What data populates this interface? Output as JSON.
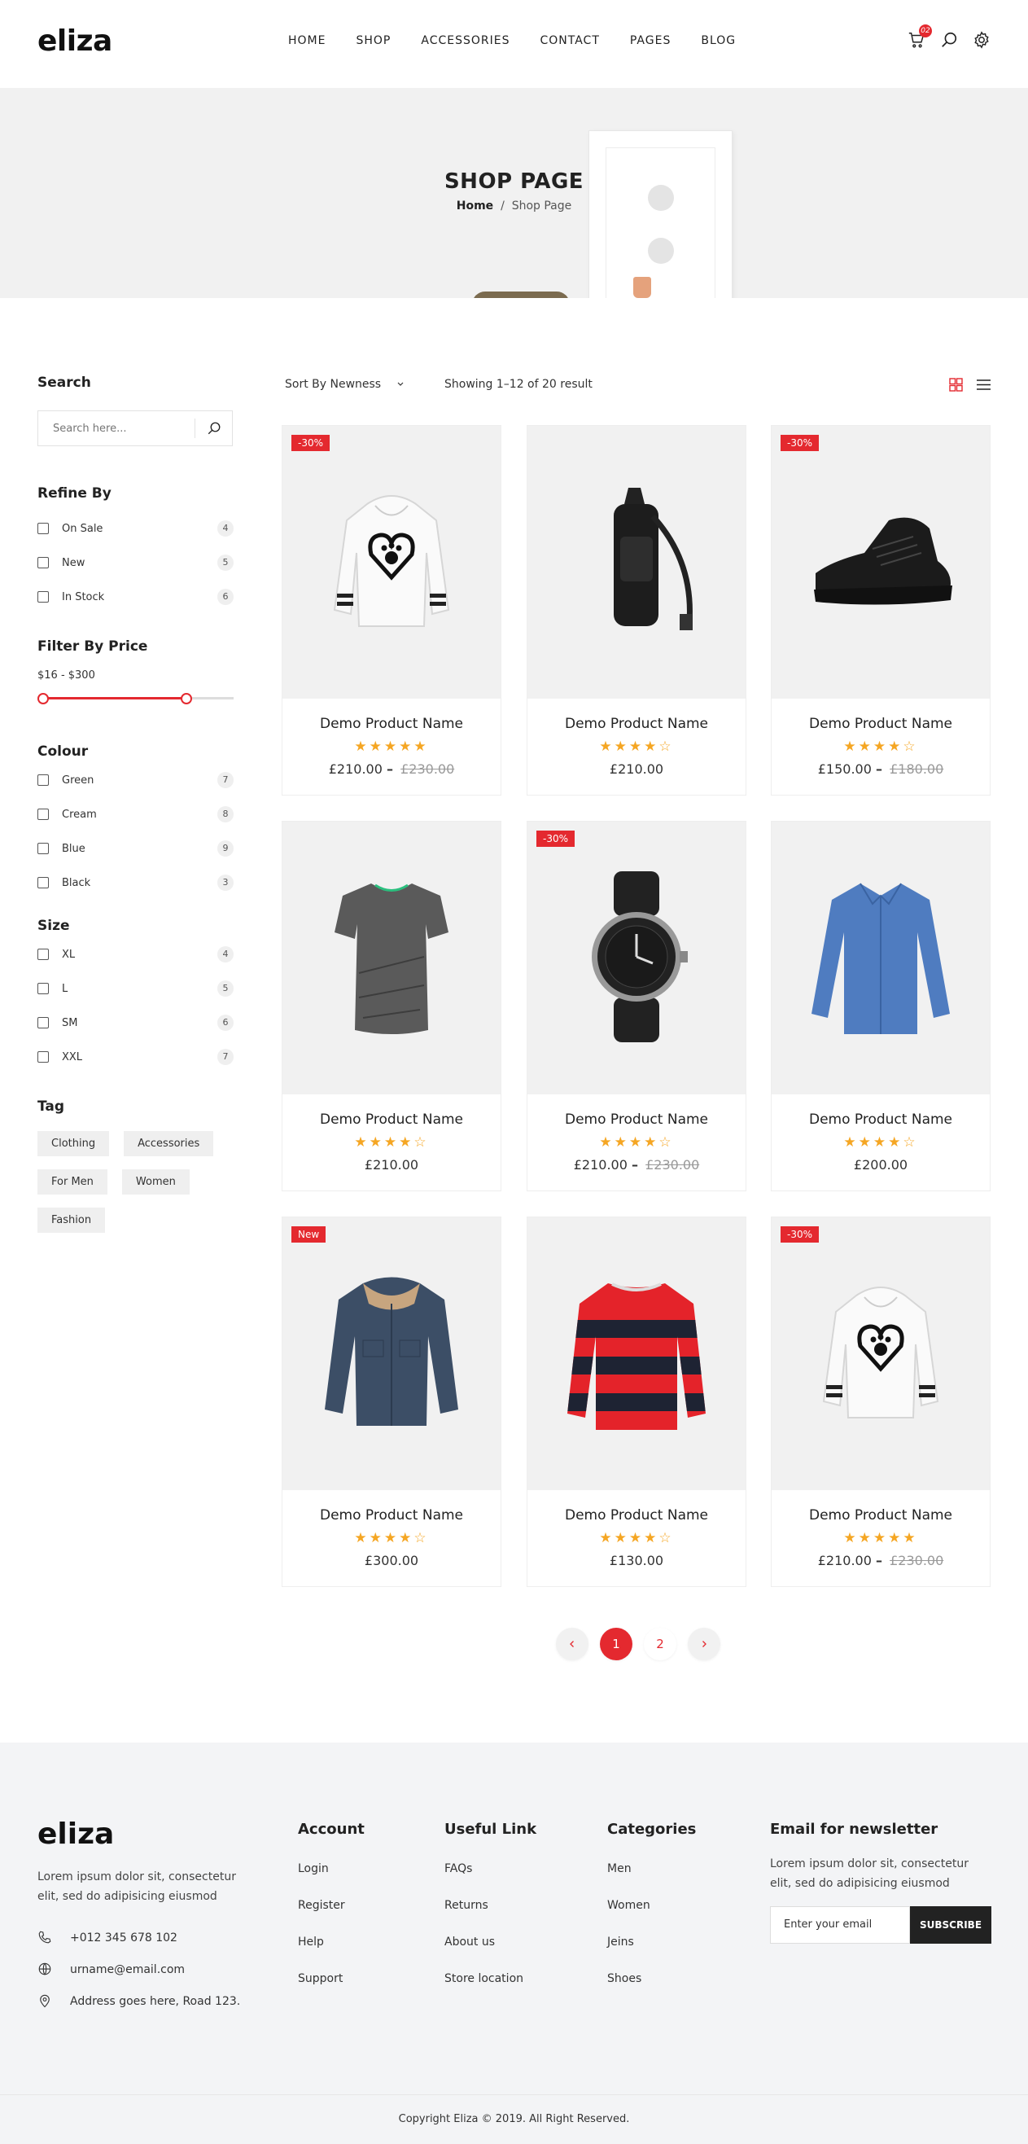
{
  "header": {
    "logo": "eliza",
    "nav": [
      "HOME",
      "SHOP",
      "ACCESSORIES",
      "CONTACT",
      "PAGES",
      "BLOG"
    ],
    "cart_count": "02"
  },
  "hero": {
    "title": "SHOP PAGE",
    "breadcrumb_home": "Home",
    "breadcrumb_sep": "/",
    "breadcrumb_current": "Shop Page"
  },
  "sidebar": {
    "search_title": "Search",
    "search_placeholder": "Search here...",
    "refine_title": "Refine By",
    "refine": [
      {
        "label": "On Sale",
        "count": "4"
      },
      {
        "label": "New",
        "count": "5"
      },
      {
        "label": "In Stock",
        "count": "6"
      }
    ],
    "price_title": "Filter By Price",
    "price_range": "$16 - $300",
    "colour_title": "Colour",
    "colours": [
      {
        "label": "Green",
        "count": "7"
      },
      {
        "label": "Cream",
        "count": "8"
      },
      {
        "label": "Blue",
        "count": "9"
      },
      {
        "label": "Black",
        "count": "3"
      }
    ],
    "size_title": "Size",
    "sizes": [
      {
        "label": "XL",
        "count": "4"
      },
      {
        "label": "L",
        "count": "5"
      },
      {
        "label": "SM",
        "count": "6"
      },
      {
        "label": "XXL",
        "count": "7"
      }
    ],
    "tag_title": "Tag",
    "tags": [
      "Clothing",
      "Accessories",
      "For Men",
      "Women",
      "Fashion"
    ]
  },
  "toolbar": {
    "sort_label": "Sort By Newness",
    "showing": "Showing 1–12 of 20 result"
  },
  "products": [
    {
      "name": "Demo Product Name",
      "badge": "-30%",
      "rating": 5,
      "price": "£210.00",
      "old_price": "£230.00",
      "image": "white-hoodie"
    },
    {
      "name": "Demo Product Name",
      "badge": "",
      "rating": 4.5,
      "price": "£210.00",
      "old_price": "",
      "image": "black-backpack"
    },
    {
      "name": "Demo Product Name",
      "badge": "-30%",
      "rating": 4.5,
      "price": "£150.00",
      "old_price": "£180.00",
      "image": "black-sneaker"
    },
    {
      "name": "Demo Product Name",
      "badge": "",
      "rating": 4.5,
      "price": "£210.00",
      "old_price": "",
      "image": "grey-tshirt"
    },
    {
      "name": "Demo Product Name",
      "badge": "-30%",
      "rating": 4.5,
      "price": "£210.00",
      "old_price": "£230.00",
      "image": "wrist-watch"
    },
    {
      "name": "Demo Product Name",
      "badge": "",
      "rating": 4.5,
      "price": "£200.00",
      "old_price": "",
      "image": "blue-shirt"
    },
    {
      "name": "Demo Product Name",
      "badge": "New",
      "rating": 4.5,
      "price": "£300.00",
      "old_price": "",
      "image": "denim-jacket"
    },
    {
      "name": "Demo Product Name",
      "badge": "",
      "rating": 4.5,
      "price": "£130.00",
      "old_price": "",
      "image": "striped-sweater"
    },
    {
      "name": "Demo Product Name",
      "badge": "-30%",
      "rating": 5,
      "price": "£210.00",
      "old_price": "£230.00",
      "image": "white-hoodie"
    }
  ],
  "pagination": [
    "1",
    "2"
  ],
  "footer": {
    "logo": "eliza",
    "desc": "Lorem ipsum dolor sit, consectetur elit, sed do adipisicing eiusmod",
    "phone": "+012 345 678 102",
    "email": "urname@email.com",
    "address": "Address goes here, Road 123.",
    "columns": [
      {
        "title": "Account",
        "links": [
          "Login",
          "Register",
          "Help",
          "Support"
        ]
      },
      {
        "title": "Useful Link",
        "links": [
          "FAQs",
          "Returns",
          "About us",
          "Store location"
        ]
      },
      {
        "title": "Categories",
        "links": [
          "Men",
          "Women",
          "Jeins",
          "Shoes"
        ]
      }
    ],
    "newsletter_title": "Email for newsletter",
    "newsletter_desc": "Lorem ipsum dolor sit, consectetur elit, sed do adipisicing eiusmod",
    "newsletter_placeholder": "Enter your email",
    "subscribe": "SUBSCRIBE",
    "copyright": "Copyright Eliza © 2019. All Right Reserved."
  },
  "colors": {
    "accent": "#e4292f",
    "star": "#f5a623",
    "footer_bg": "#f3f4f6"
  }
}
